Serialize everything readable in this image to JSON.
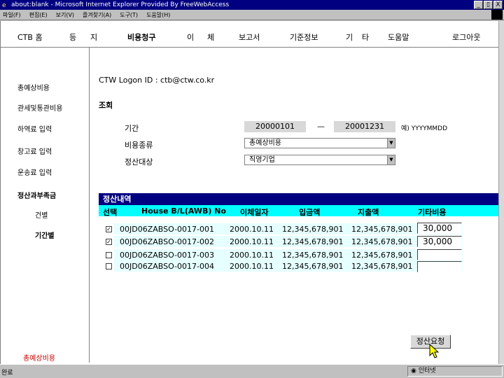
{
  "window": {
    "title": "about:blank - Microsoft Internet Explorer Provided By FreeWebAccess",
    "buttons": [
      "_",
      "▯",
      "X"
    ]
  },
  "menubar": [
    "파일(F)",
    "편집(E)",
    "보기(V)",
    "즐겨찾기(A)",
    "도구(T)",
    "도움말(H)"
  ],
  "topnav": {
    "items": [
      "CTB 홈",
      "등",
      "지",
      "비용청구",
      "이",
      "체",
      "보고서",
      "기준정보",
      "기",
      "타",
      "도움말",
      "로그아웃"
    ]
  },
  "sidebar": {
    "items": [
      "총예상비용",
      "관세및통관비용",
      "하역료 입력",
      "창고료 입력",
      "운송료 입력",
      "정산과부족금",
      "건별",
      "기간별",
      "총예상비용"
    ]
  },
  "main": {
    "logon": "CTW Logon ID : ctb@ctw.co.kr",
    "search_title": "조회",
    "period_label": "기간",
    "period_from": "20000101",
    "period_sep": "—",
    "period_to": "20001231",
    "period_hint": "예) YYYYMMDD",
    "cost_type_label": "비용종류",
    "cost_type_value": "총예상비용",
    "target_label": "정산대상",
    "target_value": "직영기업"
  },
  "table": {
    "section_title": "정산내역",
    "headers": [
      "선택",
      "House B/L(AWB) No",
      "이체일자",
      "입금액",
      "지출액",
      "기타비용"
    ],
    "rows": [
      {
        "checked": true,
        "bl": "00JD06ZABSO-0017-001",
        "date": "2000.10.11",
        "deposit": "12,345,678,901",
        "expense": "12,345,678,901",
        "other": "30,000"
      },
      {
        "checked": true,
        "bl": "00JD06ZABSO-0017-002",
        "date": "2000.10.11",
        "deposit": "12,345,678,901",
        "expense": "12,345,678,901",
        "other": "30,000"
      },
      {
        "checked": false,
        "bl": "00JD06ZABSO-0017-003",
        "date": "2000.10.11",
        "deposit": "12,345,678,901",
        "expense": "12,345,678,901",
        "other": ""
      },
      {
        "checked": false,
        "bl": "00JD06ZABSO-0017-004",
        "date": "2000.10.11",
        "deposit": "12,345,678,901",
        "expense": "12,345,678,901",
        "other": ""
      }
    ],
    "submit_label": "정산요청"
  },
  "statusbar": {
    "left": "완료",
    "zone": "인터넷"
  },
  "colors": {
    "titlebar": "#000080",
    "section_header": "#000080",
    "column_header": "#00ffff",
    "row_tint": "#e6ffff",
    "sidebar_footer": "#cc0000"
  }
}
